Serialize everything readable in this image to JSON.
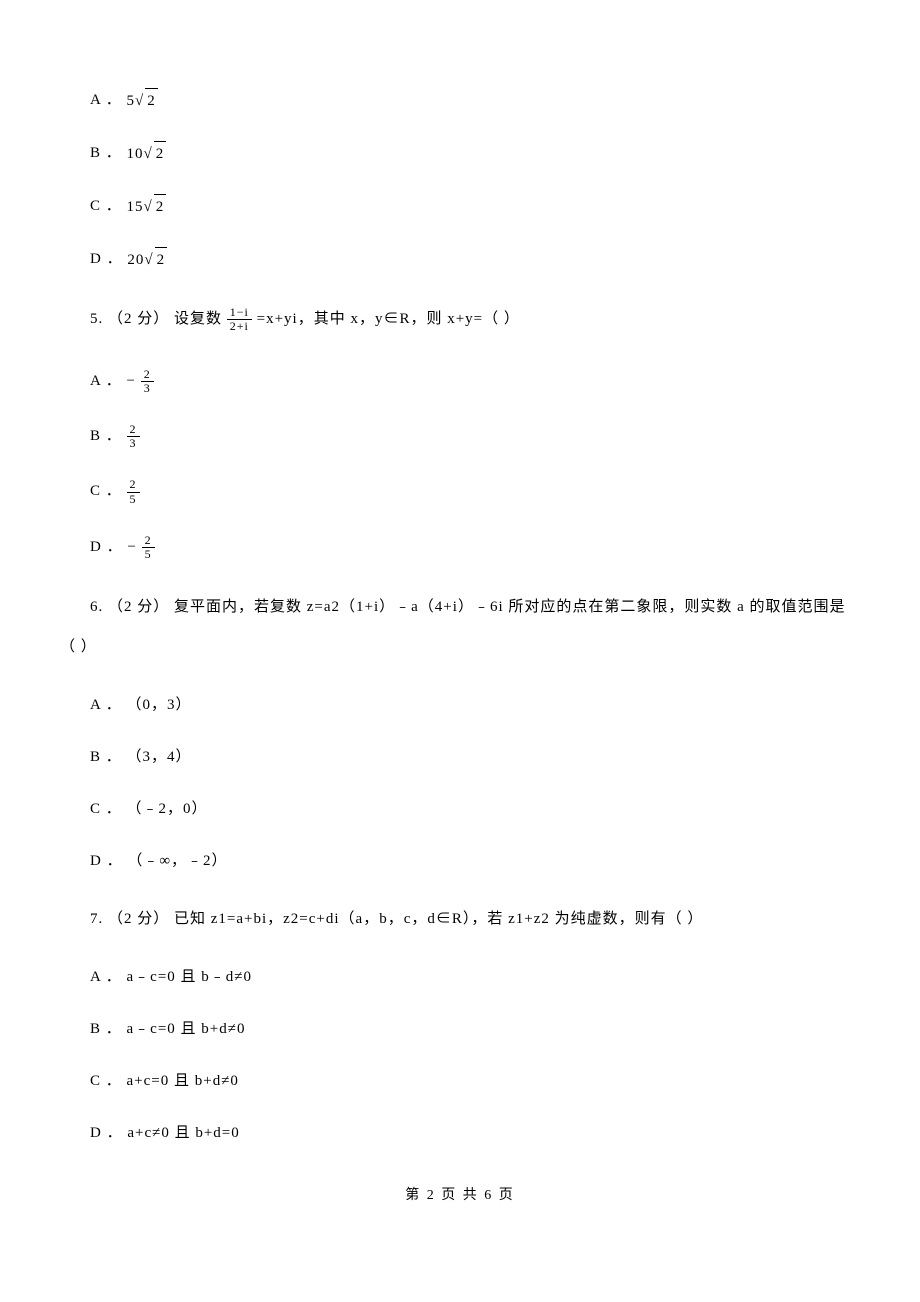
{
  "q4": {
    "A": {
      "label": "A ．",
      "pre": "5",
      "rad": "2"
    },
    "B": {
      "label": "B ．",
      "pre": "10",
      "rad": "2"
    },
    "C": {
      "label": "C ．",
      "pre": "15",
      "rad": "2"
    },
    "D": {
      "label": "D ．",
      "pre": "20",
      "rad": "2"
    }
  },
  "q5": {
    "stem_pre": "5.  （2 分） 设复数 ",
    "frac_num": "1−i",
    "frac_den": "2+i",
    "stem_post": " =x+yi，其中 x，y∈R，则 x+y=（     ）",
    "A": {
      "label": "A ．",
      "sign": "−",
      "num": "2",
      "den": "3"
    },
    "B": {
      "label": "B ．",
      "sign": "",
      "num": "2",
      "den": "3"
    },
    "C": {
      "label": "C ．",
      "sign": "",
      "num": "2",
      "den": "5"
    },
    "D": {
      "label": "D ．",
      "sign": "−",
      "num": "2",
      "den": "5"
    }
  },
  "q6": {
    "stem1": "6.  （2 分） 复平面内，若复数 z=a2（1+i）﹣a（4+i）﹣6i 所对应的点在第二象限，则实数 a 的取值范围是",
    "stem2": "（     ）",
    "A": "A ． （0，3）",
    "B": "B ． （3，4）",
    "C": "C ． （﹣2，0）",
    "D": "D ． （﹣∞，﹣2）"
  },
  "q7": {
    "stem": "7.  （2 分） 已知 z1=a+bi，z2=c+di（a，b，c，d∈R），若 z1+z2 为纯虚数，则有（     ）",
    "A": "A ． a﹣c=0 且 b﹣d≠0",
    "B": "B ． a﹣c=0 且 b+d≠0",
    "C": "C ． a+c=0 且 b+d≠0",
    "D": "D ． a+c≠0 且 b+d=0"
  },
  "footer": "第 2 页 共 6 页"
}
